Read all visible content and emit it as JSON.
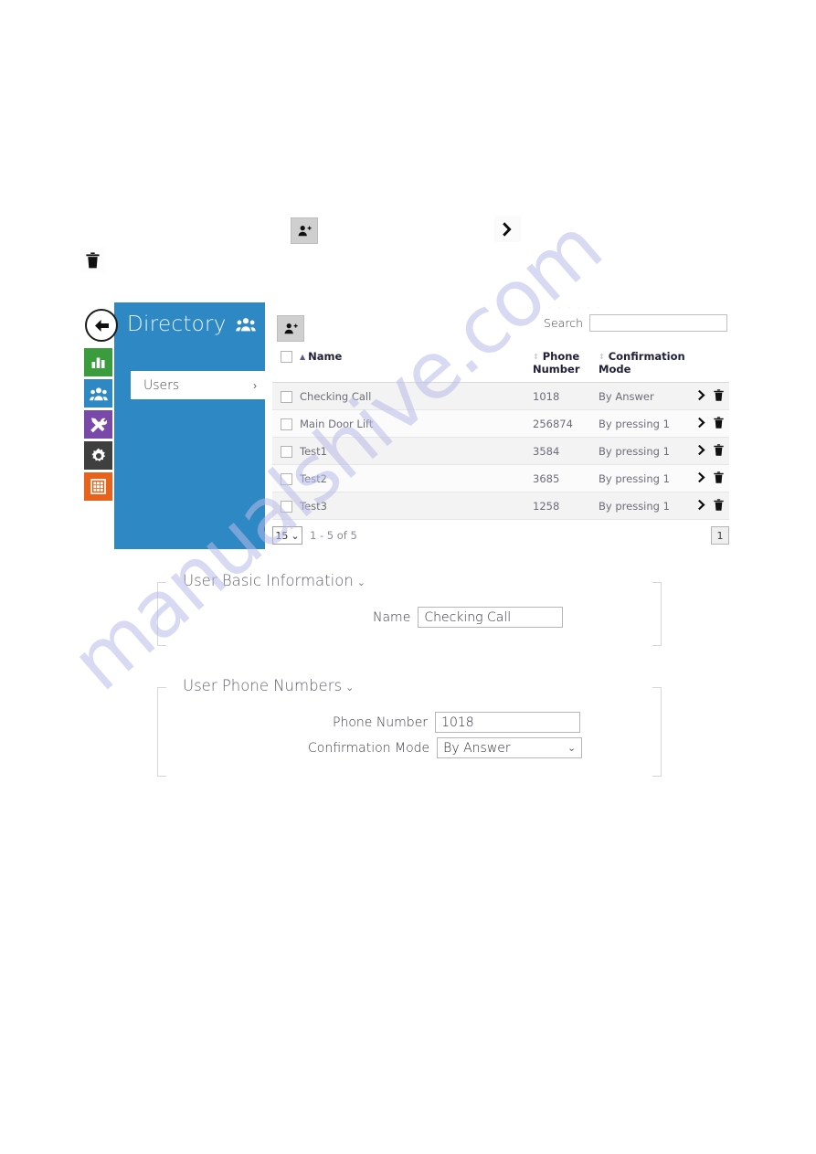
{
  "watermark": {
    "text": "manualshive.com"
  },
  "floating_icons": {
    "add_user": "add-user-icon",
    "chevron_right": "chevron-right-icon",
    "trash": "trash-icon"
  },
  "sidebar": {
    "back_button_label": "←",
    "rail_items": [
      {
        "name": "status-icon",
        "color": "#3a9c3d"
      },
      {
        "name": "directory-icon",
        "color": "#2e88c4"
      },
      {
        "name": "hardware-icon",
        "color": "#7a48a8"
      },
      {
        "name": "system-icon",
        "color": "#3f3f3f"
      },
      {
        "name": "apps-icon",
        "color": "#e8621c"
      }
    ],
    "panel_title": "Directory",
    "panel_icon": "users-group-icon",
    "menu_items": [
      {
        "label": "Users",
        "chevron": "›",
        "selected": true
      }
    ]
  },
  "content": {
    "cut_strip_text": "· · · · · · · ·",
    "add_user_button": "add-user-icon",
    "search": {
      "label": "Search",
      "value": "",
      "placeholder": ""
    },
    "table": {
      "columns": [
        {
          "key": "check",
          "label": ""
        },
        {
          "key": "name",
          "label": "Name",
          "sorted": true,
          "sort_dir": "asc"
        },
        {
          "key": "phone",
          "label": "Phone Number",
          "sorted": false
        },
        {
          "key": "mode",
          "label": "Confirmation Mode",
          "sorted": false
        },
        {
          "key": "actions",
          "label": ""
        }
      ],
      "rows": [
        {
          "name": "Checking Call",
          "phone": "1018",
          "mode": "By Answer"
        },
        {
          "name": "Main Door Lift",
          "phone": "256874",
          "mode": "By pressing 1"
        },
        {
          "name": "Test1",
          "phone": "3584",
          "mode": "By pressing 1"
        },
        {
          "name": "Test2",
          "phone": "3685",
          "mode": "By pressing 1"
        },
        {
          "name": "Test3",
          "phone": "1258",
          "mode": "By pressing 1"
        }
      ]
    },
    "pagination": {
      "page_size": "15",
      "page_size_caret": "⌄",
      "range_text": "1 - 5 of 5",
      "current_page": "1"
    }
  },
  "forms": [
    {
      "legend": "User Basic Information",
      "caret": "⌄",
      "fields": [
        {
          "label": "Name",
          "value": "Checking Call",
          "type": "text"
        }
      ]
    },
    {
      "legend": "User Phone Numbers",
      "caret": "⌄",
      "fields": [
        {
          "label": "Phone Number",
          "value": "1018",
          "type": "text"
        },
        {
          "label": "Confirmation Mode",
          "value": "By Answer",
          "type": "select"
        }
      ]
    }
  ],
  "colors": {
    "brand_blue": "#2e88c4",
    "green": "#3a9c3d",
    "purple": "#7a48a8",
    "dark": "#3f3f3f",
    "orange": "#e8621c",
    "watermark": "#b9bbe8"
  }
}
